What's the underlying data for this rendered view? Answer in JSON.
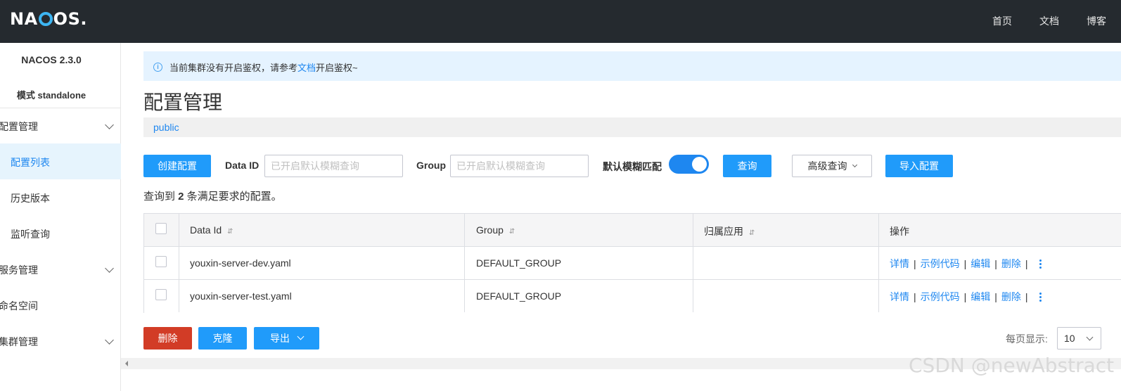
{
  "header": {
    "logo": {
      "text_before": "NA",
      "text_after": "OS."
    },
    "nav": [
      {
        "label": "首页"
      },
      {
        "label": "文档"
      },
      {
        "label": "博客"
      }
    ]
  },
  "sidebar": {
    "version": "NACOS 2.3.0",
    "mode": "模式 standalone",
    "items": [
      {
        "label": "配置管理",
        "expandable": true
      },
      {
        "label": "配置列表",
        "active": true
      },
      {
        "label": "历史版本"
      },
      {
        "label": "监听查询"
      },
      {
        "label": "服务管理",
        "expandable": true
      },
      {
        "label": "命名空间"
      },
      {
        "label": "集群管理",
        "expandable": true
      }
    ]
  },
  "alert": {
    "prefix": "当前集群没有开启鉴权，请参考",
    "link": "文档",
    "suffix": "开启鉴权~"
  },
  "page": {
    "title": "配置管理",
    "namespace": "public"
  },
  "toolbar": {
    "create_label": "创建配置",
    "data_id_label": "Data ID",
    "data_id_placeholder": "已开启默认模糊查询",
    "group_label": "Group",
    "group_placeholder": "已开启默认模糊查询",
    "fuzzy_label": "默认模糊匹配",
    "fuzzy_enabled": true,
    "query_label": "查询",
    "advanced_label": "高级查询",
    "import_label": "导入配置"
  },
  "result": {
    "prefix": "查询到 ",
    "count": "2",
    "suffix": " 条满足要求的配置。"
  },
  "table": {
    "headers": {
      "data_id": "Data Id",
      "group": "Group",
      "app": "归属应用",
      "actions": "操作"
    },
    "sort_glyph": "⇵",
    "rows": [
      {
        "data_id": "youxin-server-dev.yaml",
        "group": "DEFAULT_GROUP",
        "app": ""
      },
      {
        "data_id": "youxin-server-test.yaml",
        "group": "DEFAULT_GROUP",
        "app": ""
      }
    ],
    "actions": {
      "detail": "详情",
      "sample": "示例代码",
      "edit": "编辑",
      "delete": "删除",
      "sep": "|"
    }
  },
  "footer": {
    "delete_label": "删除",
    "clone_label": "克隆",
    "export_label": "导出",
    "page_size_label": "每页显示:",
    "page_size_value": "10"
  },
  "watermark": "CSDN @newAbstract",
  "colors": {
    "topbar": "#252a2f",
    "primary": "#209bfa",
    "danger": "#d23c26",
    "link": "#1e87f0",
    "active_bg": "#e6f4fd"
  }
}
